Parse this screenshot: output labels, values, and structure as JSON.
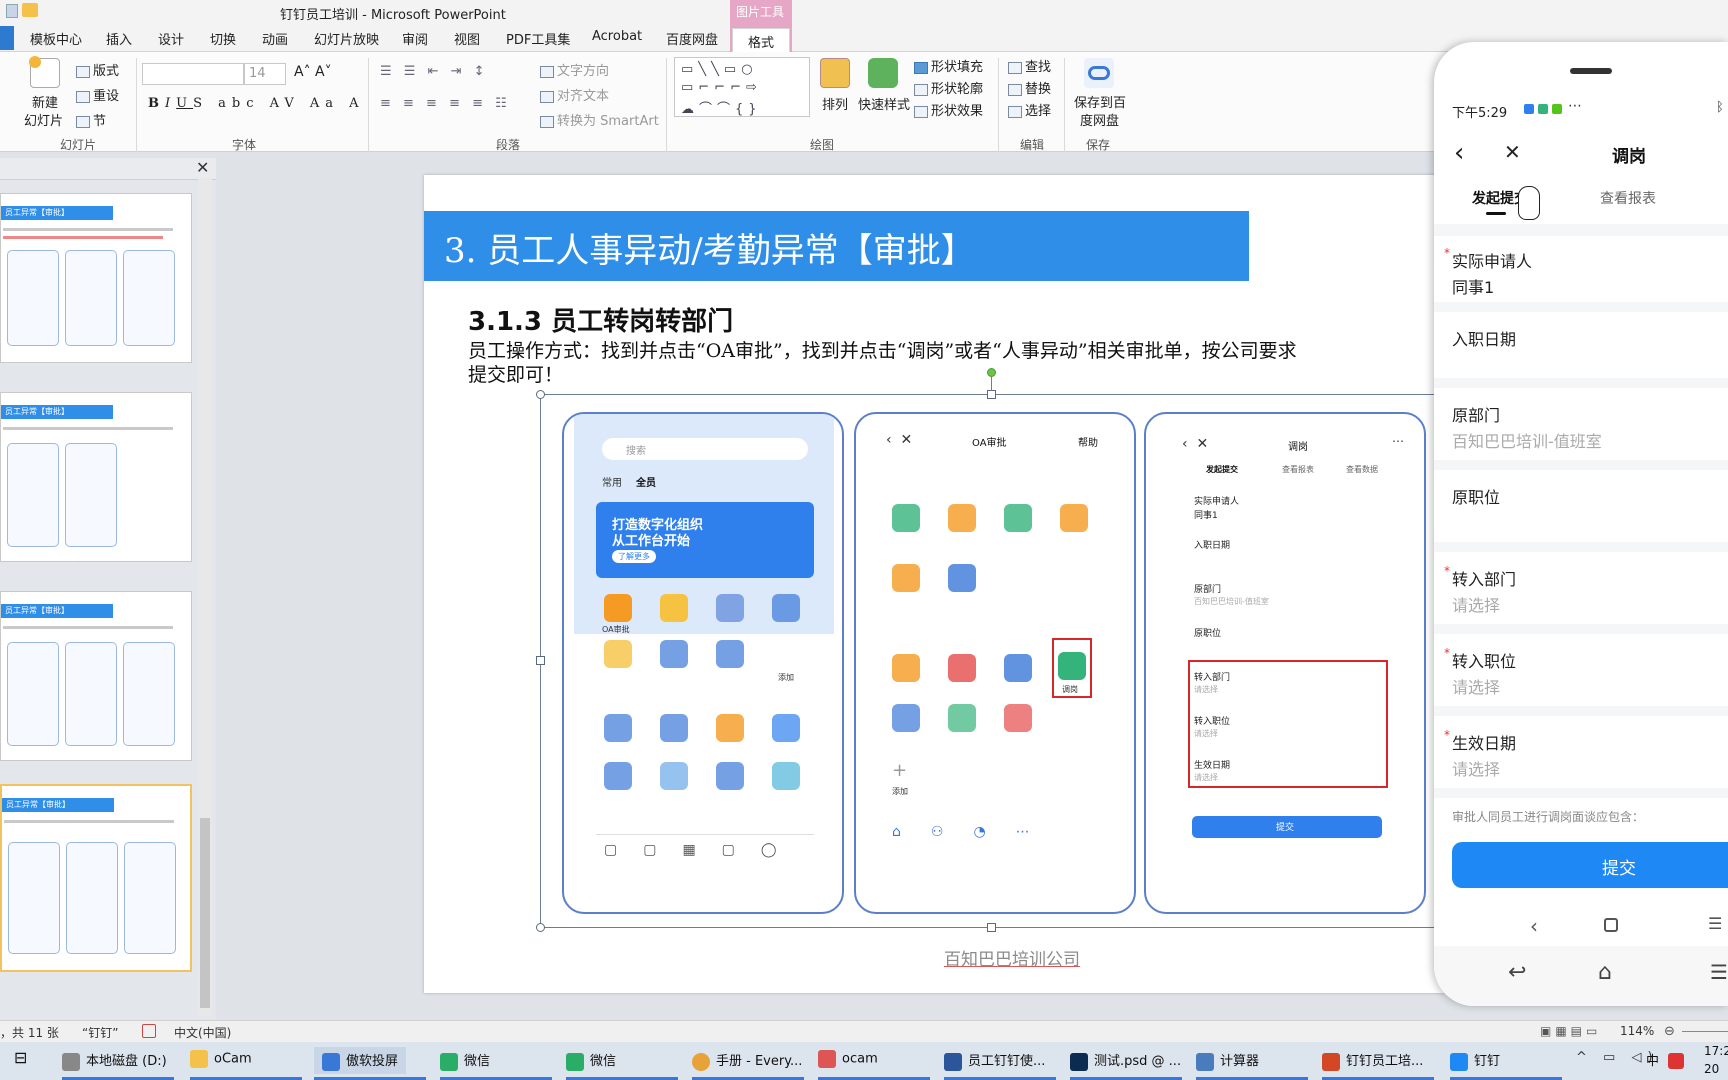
{
  "window": {
    "title": "钉钉员工培训 - Microsoft PowerPoint"
  },
  "ribbon_tabs": [
    "模板中心",
    "插入",
    "设计",
    "切换",
    "动画",
    "幻灯片放映",
    "审阅",
    "视图",
    "PDF工具集",
    "Acrobat",
    "百度网盘"
  ],
  "picture_tools": {
    "label": "图片工具",
    "format_tab": "格式"
  },
  "ribbon": {
    "slides": {
      "new_slide": "新建",
      "new_slide2": "幻灯片",
      "layout": "版式",
      "reset": "重设",
      "section": "节",
      "group": "幻灯片"
    },
    "font": {
      "size": "14",
      "group": "字体"
    },
    "paragraph": {
      "text_direction": "文字方向",
      "align_text": "对齐文本",
      "convert_smartart": "转换为 SmartArt",
      "group": "段落"
    },
    "drawing": {
      "arrange": "排列",
      "quick_styles": "快速样式",
      "shape_fill": "形状填充",
      "shape_outline": "形状轮廓",
      "shape_effects": "形状效果",
      "group": "绘图"
    },
    "editing": {
      "find": "查找",
      "replace": "替换",
      "select": "选择",
      "group": "编辑"
    },
    "save": {
      "save_to_baidu": "保存到百",
      "save_to_baidu2": "度网盘",
      "group": "保存"
    }
  },
  "slide_panel": {
    "thumbs": [
      {
        "title": "员工异常【审批】"
      },
      {
        "title": "员工异常【审批】"
      },
      {
        "title": "员工异常【审批】"
      },
      {
        "title": "员工异常【审批】"
      }
    ]
  },
  "slide": {
    "title": "3. 员工人事异动/考勤异常【审批】",
    "subtitle": "3.1.3 员工转岗转部门",
    "body_line1": "员工操作方式：找到并点击“OA审批”，找到并点击“调岗”或者“人事异动”相关审批单，按公司要求",
    "body_line2": "提交即可！",
    "footer": "百知巴巴培训公司",
    "phone1": {
      "search": "搜索",
      "tab_common": "常用",
      "tab_all": "全员",
      "banner1": "打造数字化组织",
      "banner2": "从工作台开始",
      "banner_btn": "了解更多",
      "oa": "OA审批",
      "add": "添加"
    },
    "phone2": {
      "title": "OA审批",
      "help": "帮助",
      "tiaogang": "调岗",
      "add": "添加"
    },
    "phone3": {
      "title": "调岗",
      "tab1": "发起提交",
      "tab2": "查看报表",
      "tab3": "查看数据",
      "applicant": "实际申请人",
      "applicant_val": "同事1",
      "entry_date": "入职日期",
      "orig_dept": "原部门",
      "orig_dept_val": "百知巴巴培训-值班室",
      "orig_pos": "原职位",
      "to_dept": "转入部门",
      "to_pos": "转入职位",
      "eff_date": "生效日期",
      "placeholder": "请选择",
      "submit": "提交"
    }
  },
  "mobile": {
    "time": "下午5:29",
    "title": "调岗",
    "tab_submit": "发起提交",
    "tab_report": "查看报表",
    "applicant_label": "实际申请人",
    "applicant_value": "同事1",
    "entry_date_label": "入职日期",
    "orig_dept_label": "原部门",
    "orig_dept_value": "百知巴巴培训-值班室",
    "orig_pos_label": "原职位",
    "to_dept_label": "转入部门",
    "to_pos_label": "转入职位",
    "eff_date_label": "生效日期",
    "placeholder": "请选择",
    "note": "审批人同员工进行调岗面谈应包含：",
    "submit": "提交"
  },
  "statusbar": {
    "slide_info": "，共 11 张",
    "theme": "“钉钉”",
    "language": "中文(中国)",
    "zoom": "114%"
  },
  "taskbar": {
    "items": [
      "本地磁盘 (D:)",
      "oCam",
      "傲软投屏",
      "微信",
      "微信",
      "手册 - Every...",
      "ocam",
      "员工钉钉使...",
      "测试.psd @ ...",
      "计算器",
      "钉钉员工培...",
      "钉钉"
    ],
    "tray_ime": "中",
    "clock": "17:2",
    "date": "20"
  }
}
